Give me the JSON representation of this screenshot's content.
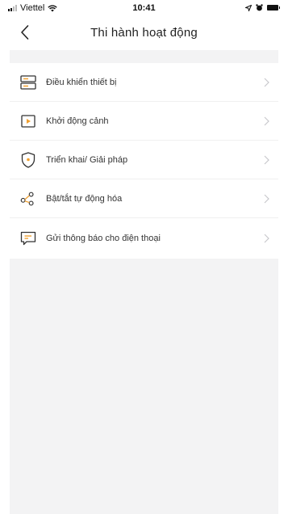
{
  "status_bar": {
    "carrier": "Viettel",
    "time": "10:41"
  },
  "nav": {
    "title": "Thi hành hoạt động"
  },
  "items": [
    {
      "label": "Điều khiển thiết bị",
      "icon": "device-control-icon"
    },
    {
      "label": "Khởi động cảnh",
      "icon": "play-scene-icon"
    },
    {
      "label": "Triển khai/ Giải pháp",
      "icon": "shield-icon"
    },
    {
      "label": "Bật/tắt tự động hóa",
      "icon": "automation-nodes-icon"
    },
    {
      "label": "Gửi thông báo cho điện thoại",
      "icon": "message-icon"
    }
  ],
  "colors": {
    "accent": "#f0a030",
    "background": "#f3f3f4",
    "chevron": "#c8c8cc"
  }
}
